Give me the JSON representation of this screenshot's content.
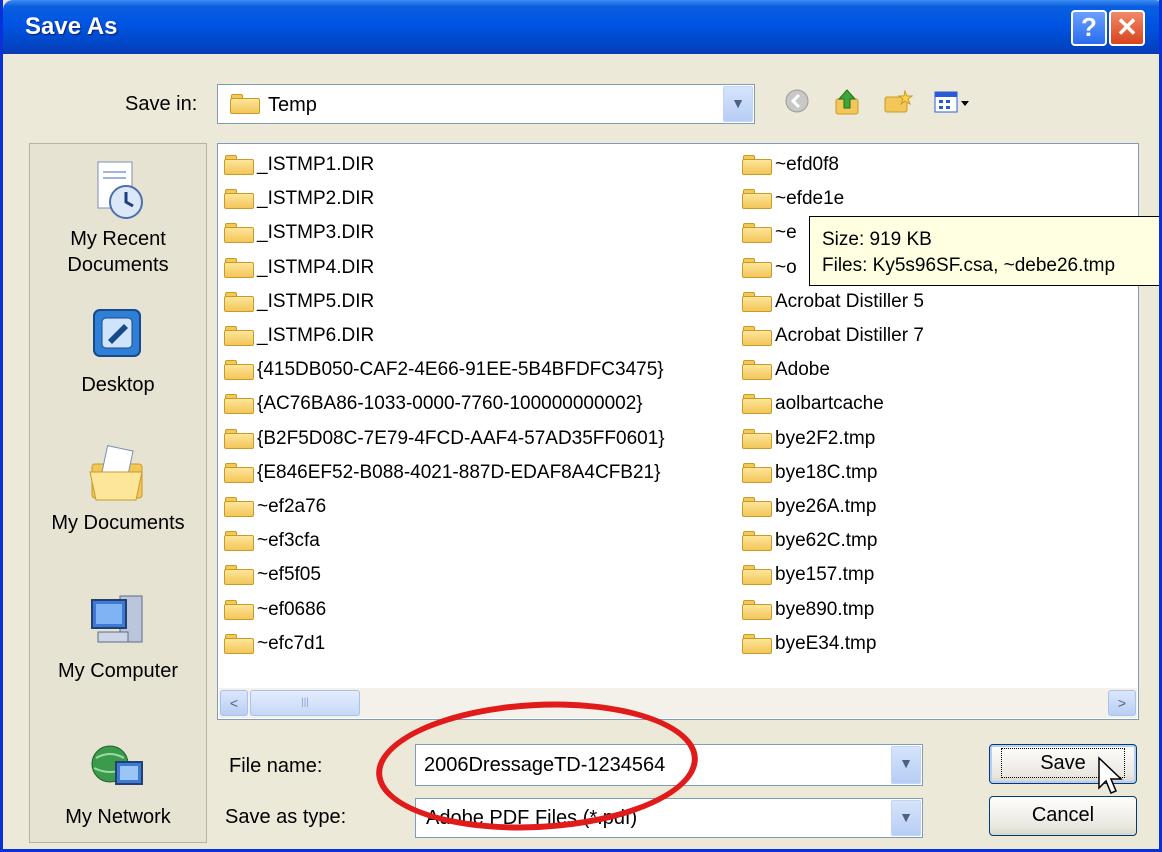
{
  "window": {
    "title": "Save As",
    "help_label": "?",
    "close_label": "✕"
  },
  "save_in": {
    "label": "Save in:",
    "value": "Temp",
    "toolbar_icons": [
      "back-icon",
      "up-folder-icon",
      "new-folder-icon",
      "views-menu-icon"
    ]
  },
  "places": [
    {
      "label_line1": "My Recent",
      "label_line2": "Documents",
      "icon": "recent-documents-icon"
    },
    {
      "label_line1": "Desktop",
      "label_line2": "",
      "icon": "desktop-icon"
    },
    {
      "label_line1": "My Documents",
      "label_line2": "",
      "icon": "my-documents-icon"
    },
    {
      "label_line1": "My Computer",
      "label_line2": "",
      "icon": "my-computer-icon"
    },
    {
      "label_line1": "My Network",
      "label_line2": "",
      "icon": "my-network-icon"
    }
  ],
  "files": {
    "col1": [
      "_ISTMP1.DIR",
      "_ISTMP2.DIR",
      "_ISTMP3.DIR",
      "_ISTMP4.DIR",
      "_ISTMP5.DIR",
      "_ISTMP6.DIR",
      "{415DB050-CAF2-4E66-91EE-5B4BFDFC3475}",
      "{AC76BA86-1033-0000-7760-100000000002}",
      "{B2F5D08C-7E79-4FCD-AAF4-57AD35FF0601}",
      "{E846EF52-B088-4021-887D-EDAF8A4CFB21}",
      "~ef2a76",
      "~ef3cfa",
      "~ef5f05",
      "~ef0686",
      "~efc7d1"
    ],
    "col2": [
      "~efd0f8",
      "~efde1e",
      "~e",
      "~o",
      "Acrobat Distiller 5",
      "Acrobat Distiller 7",
      "Adobe",
      "aolbartcache",
      "bye2F2.tmp",
      "bye18C.tmp",
      "bye26A.tmp",
      "bye62C.tmp",
      "bye157.tmp",
      "bye890.tmp",
      "byeE34.tmp"
    ]
  },
  "tooltip": {
    "size": "Size: 919 KB",
    "files": "Files: Ky5s96SF.csa, ~debe26.tmp"
  },
  "scroll": {
    "left": "<",
    "right": ">",
    "thumb": "|||"
  },
  "file_name": {
    "label": "File name:",
    "value": "2006DressageTD-1234564"
  },
  "save_type": {
    "label": "Save as type:",
    "value": "Adobe PDF Files (*.pdf)"
  },
  "buttons": {
    "save": "Save",
    "cancel": "Cancel"
  },
  "colors": {
    "titlebar": "#0054e3",
    "annotation": "#e11a1a",
    "tooltip_bg": "#ffffe1"
  }
}
